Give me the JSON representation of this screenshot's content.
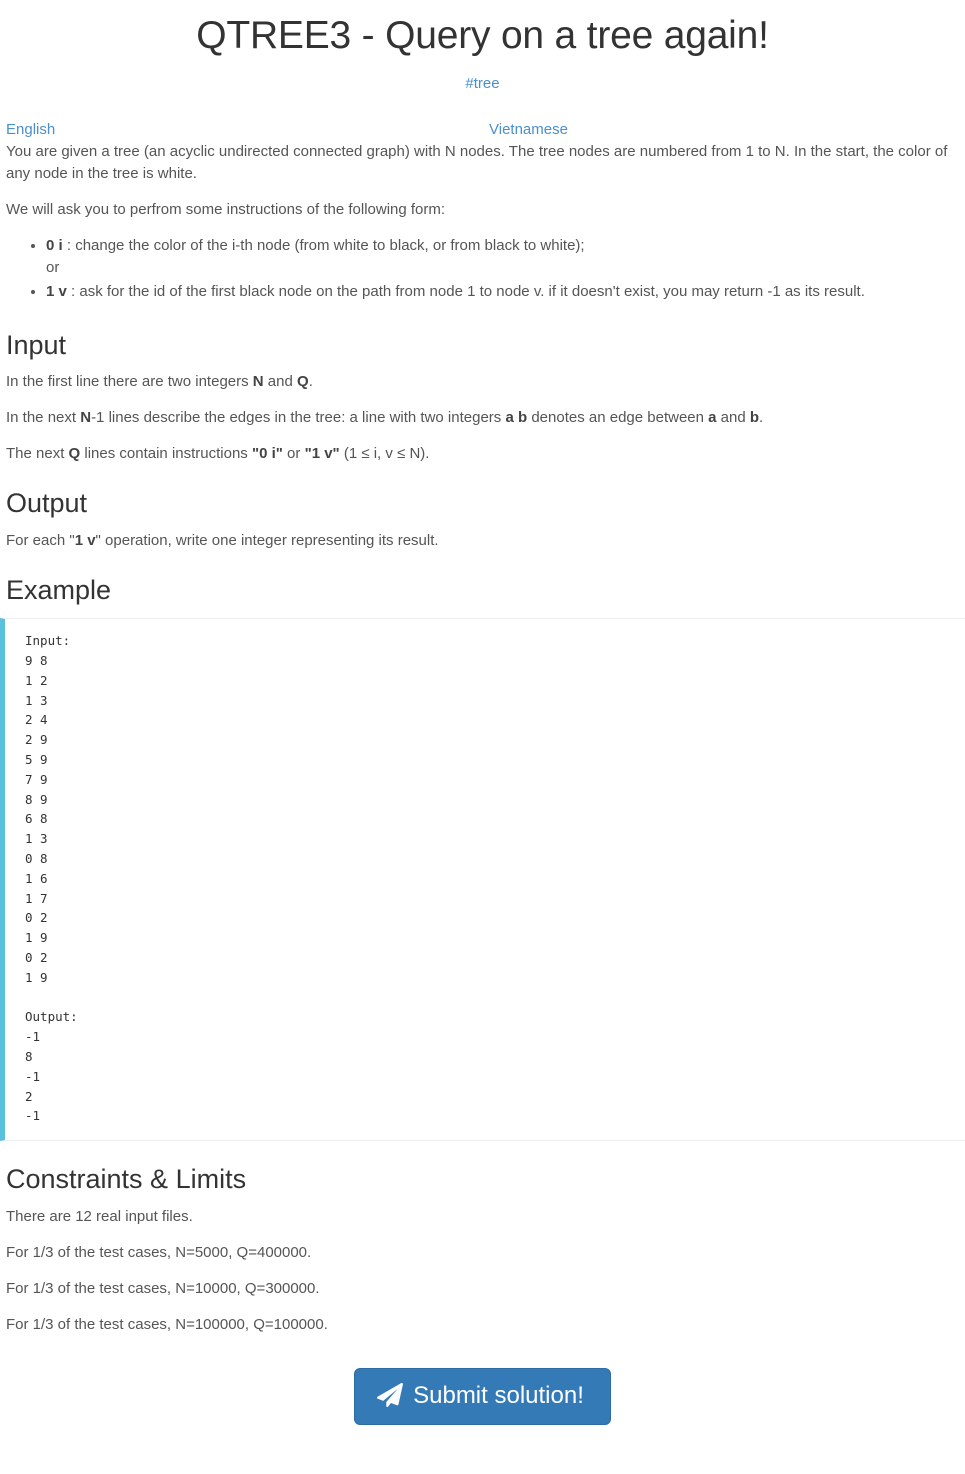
{
  "header": {
    "title": "QTREE3 - Query on a tree again!",
    "tag": "#tree"
  },
  "languages": {
    "english": "English",
    "vietnamese": "Vietnamese"
  },
  "statement": {
    "intro": "You are given a tree (an acyclic undirected connected graph) with N nodes. The tree nodes are numbered from 1 to N. In the start, the color of any node in the tree is white.",
    "ask": "We will ask you to perfrom some instructions of the following form:",
    "instructions": [
      {
        "code": "0 i",
        "text": " : change the color of the i-th node (from white to black, or from black to white);",
        "sub": "or"
      },
      {
        "code": "1 v",
        "text": " : ask for the id of the first black node on the path from node 1 to node v. if it doesn't exist, you may return -1 as its result.",
        "sub": ""
      }
    ]
  },
  "input_section": {
    "heading": "Input",
    "line1_a": "In the first line there are two integers ",
    "line1_n": "N",
    "line1_b": " and ",
    "line1_q": "Q",
    "line1_c": ".",
    "line2_a": "In the next ",
    "line2_n": "N",
    "line2_b": "-1 lines describe the edges in the tree: a line with two integers ",
    "line2_ab": "a b",
    "line2_c": " denotes an edge between ",
    "line2_a2": "a",
    "line2_d": " and ",
    "line2_b2": "b",
    "line2_e": ".",
    "line3_a": "The next ",
    "line3_q": "Q",
    "line3_b": " lines contain instructions ",
    "line3_c1": "\"0 i\"",
    "line3_c": " or ",
    "line3_c2": "\"1 v\"",
    "line3_d": " (1 ≤ i, v ≤ N)."
  },
  "output_section": {
    "heading": "Output",
    "text_a": "For each \"",
    "text_code": "1 v",
    "text_b": "\" operation, write one integer representing its result."
  },
  "example_section": {
    "heading": "Example",
    "code": "Input:\n9 8\n1 2\n1 3\n2 4\n2 9\n5 9\n7 9\n8 9\n6 8\n1 3\n0 8\n1 6\n1 7\n0 2\n1 9\n0 2\n1 9\n\nOutput:\n-1\n8\n-1\n2\n-1"
  },
  "constraints_section": {
    "heading": "Constraints & Limits",
    "lines": [
      "There are 12 real input files.",
      "For 1/3 of the test cases, N=5000, Q=400000.",
      "For 1/3 of the test cases, N=10000, Q=300000.",
      "For 1/3 of the test cases, N=100000, Q=100000."
    ]
  },
  "submit": {
    "label": "Submit solution!",
    "icon": "paper-plane-icon"
  },
  "colors": {
    "link": "#4a8fd0",
    "primary": "#337ab7",
    "code_accent": "#5bc0de",
    "heading": "#333333",
    "body": "#555555"
  }
}
